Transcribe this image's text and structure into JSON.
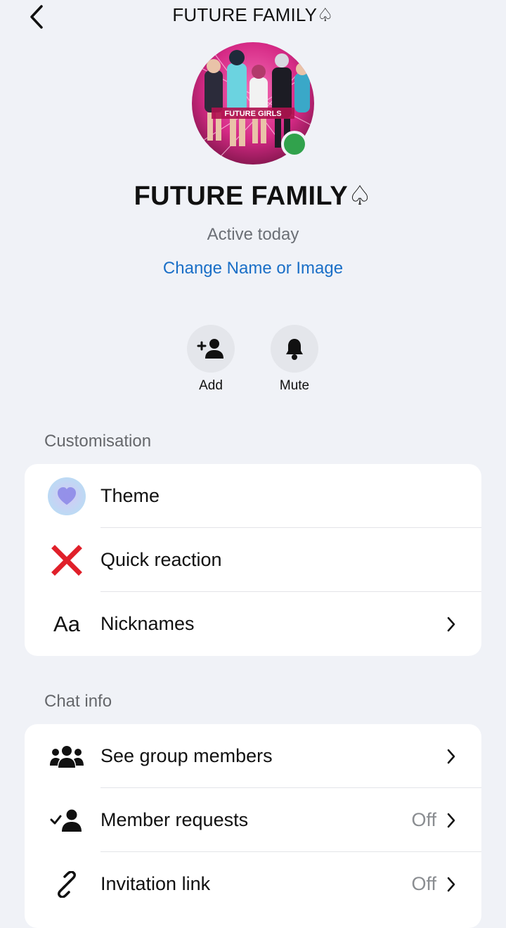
{
  "header": {
    "title": "FUTURE FAMILY♤"
  },
  "profile": {
    "name": "FUTURE FAMILY♤",
    "status": "Active today",
    "change_link": "Change Name or Image",
    "avatar_caption": "FUTURE GIRLS",
    "online_color": "#31a24c"
  },
  "actions": [
    {
      "label": "Add",
      "icon": "add-person-icon"
    },
    {
      "label": "Mute",
      "icon": "bell-icon"
    }
  ],
  "customisation": {
    "header": "Customisation",
    "items": [
      {
        "label": "Theme",
        "icon": "theme-heart-icon"
      },
      {
        "label": "Quick reaction",
        "icon": "red-cross-icon"
      },
      {
        "label": "Nicknames",
        "icon": "aa-icon",
        "glyph": "Aa"
      }
    ]
  },
  "chat_info": {
    "header": "Chat info",
    "items": [
      {
        "label": "See group members",
        "icon": "group-members-icon"
      },
      {
        "label": "Member requests",
        "icon": "member-requests-icon",
        "value": "Off"
      },
      {
        "label": "Invitation link",
        "icon": "link-icon",
        "value": "Off"
      }
    ]
  },
  "colors": {
    "accent": "#1a6fc7",
    "background": "#f0f2f7",
    "reaction": "#e0202a"
  }
}
